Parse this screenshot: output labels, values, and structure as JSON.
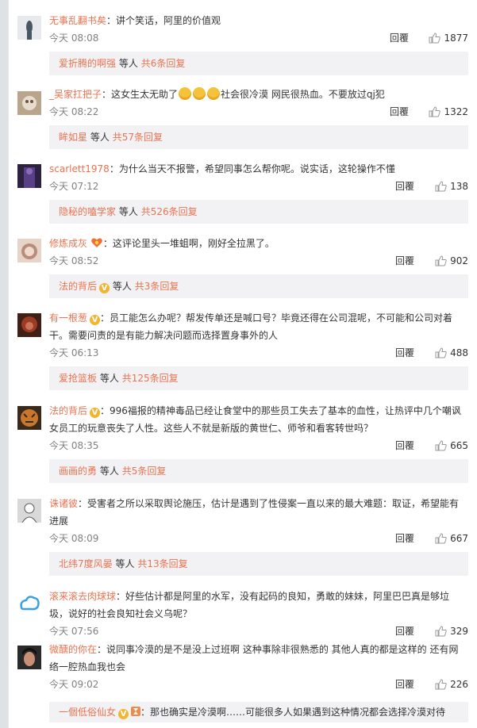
{
  "reply_label": "回覆",
  "connector": "等人",
  "comments": [
    {
      "user": "无事乱翻书矣",
      "verified": false,
      "text": "：讲个笑话，阿里的价值观",
      "time": "今天 08:08",
      "likes": "1877",
      "sub_user": "爱折腾的啊强",
      "sub_count": "共6条回复",
      "avatar_colors": [
        "#4a5563",
        "#e7e9ec"
      ]
    },
    {
      "user": "_吴家扛把子",
      "verified": false,
      "text_before": "：这女生太无助了",
      "emoji_count": 3,
      "text_after": "社会很冷漠 网民很热血。不要放过qj犯",
      "time": "今天 08:22",
      "likes": "1322",
      "sub_user": "眸如星",
      "sub_count": "共57条回复",
      "avatar_colors": [
        "#b9a48c",
        "#6b5442"
      ]
    },
    {
      "user": "scarlett1978",
      "verified": false,
      "text": "：为什么当天不报警，希望同事怎么帮你呢。说实话，这轮操作不懂",
      "time": "今天 07:12",
      "likes": "138",
      "sub_user": "隐秘的嗑学家",
      "sub_count": "共526条回复",
      "avatar_colors": [
        "#5b3f86",
        "#2c2140"
      ]
    },
    {
      "user": "修炼成灰",
      "verified": false,
      "heart_badge": true,
      "text": "：这评论里头一堆蛆啊，刚好全拉黑了。",
      "time": "今天 08:52",
      "likes": "902",
      "sub_user": "法的背后",
      "sub_verified": true,
      "sub_count": "共3条回复",
      "avatar_colors": [
        "#e7d4c8",
        "#b78c7a"
      ]
    },
    {
      "user": "有一根葱",
      "verified": true,
      "text": "：员工能怎么办呢？帮发传单还是喊口号？毕竟还得在公司混呢，不可能和公司对着干。需要问责的是有能力解决问题而选择置身事外的人",
      "time": "今天 06:13",
      "likes": "488",
      "sub_user": "爱抢篮板",
      "sub_count": "共125条回复",
      "avatar_colors": [
        "#9a3b22",
        "#3f1f16"
      ]
    },
    {
      "user": "法的背后",
      "verified": true,
      "text": "：996福报的精神毒品已经让食堂中的那些员工失去了基本的血性，让热评中几个嘲讽女员工的玩意丧失了人性。这些人不就是新版的黄世仁、师爷和看客转世吗？",
      "time": "今天 08:35",
      "likes": "665",
      "sub_user": "画画的勇",
      "sub_count": "共5条回复",
      "avatar_colors": [
        "#c9772d",
        "#3a2a1c"
      ]
    },
    {
      "user": "诛诸彼",
      "verified": false,
      "text": "：受害者之所以采取舆论施压，估计是遇到了性侵案一直以来的最大难题：取证，希望能有进展",
      "time": "今天 08:09",
      "likes": "667",
      "sub_user": "北纬7度风晏",
      "sub_count": "共13条回复",
      "avatar_colors": [
        "#d9d9d9",
        "#555555"
      ]
    },
    {
      "user": "滚来滚去肉球球",
      "verified": false,
      "text": "：好些估计都是阿里的水军，没有起码的良知，勇敢的妹妹，阿里巴巴真是够垃圾，说好的社会良知社会义乌呢？",
      "time": "今天 07:56",
      "likes": "329",
      "avatar_colors": [
        "#3aa0e6",
        "#ffffff"
      ]
    },
    {
      "user": "微醺的你在",
      "verified": false,
      "text": "：说同事冷漠的是不是没上过班啊 这种事除非很熟悉的 其他人真的都是这样的 还有网络一腔热血我也会",
      "time": "今天 09:02",
      "likes": "226",
      "avatar_colors": [
        "#2a2a2a",
        "#c98f74"
      ]
    },
    {
      "user": "一個低俗仙女",
      "verified": true,
      "text": "：那也确实是冷漠啊……可能很多人如果遇到这种情况都会选择冷漠对待",
      "time": "",
      "likes": "",
      "avatar_colors": [
        "#ddd",
        "#aaa"
      ]
    }
  ]
}
